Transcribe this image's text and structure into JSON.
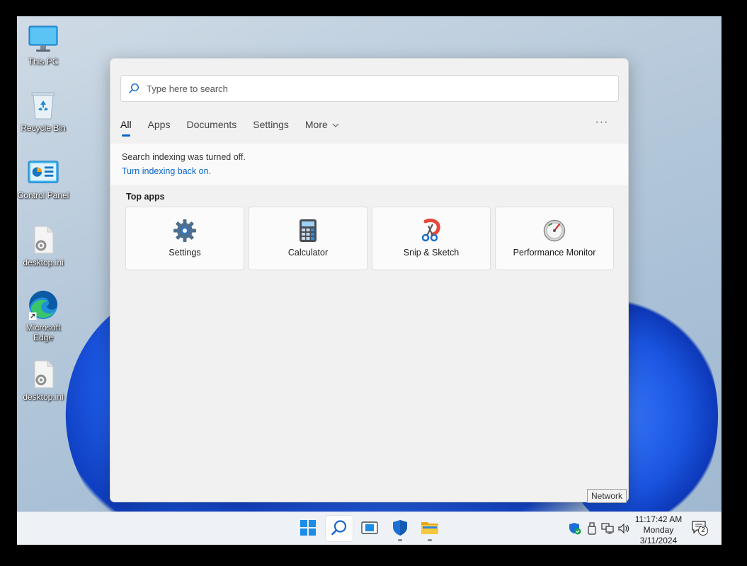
{
  "desktop": {
    "icons": [
      {
        "label": "This PC",
        "icon": "monitor-icon"
      },
      {
        "label": "Recycle Bin",
        "icon": "recycle-bin-icon"
      },
      {
        "label": "Control Panel",
        "icon": "control-panel-icon"
      },
      {
        "label": "desktop.ini",
        "icon": "settings-file-icon"
      },
      {
        "label": "Microsoft Edge",
        "icon": "edge-icon"
      },
      {
        "label": "desktop.ini",
        "icon": "settings-file-icon"
      }
    ]
  },
  "search": {
    "placeholder": "Type here to search",
    "tabs": [
      {
        "label": "All",
        "active": true
      },
      {
        "label": "Apps"
      },
      {
        "label": "Documents"
      },
      {
        "label": "Settings"
      },
      {
        "label": "More",
        "icon": "chevron-down-icon"
      }
    ],
    "more_options": "···",
    "notice_text": "Search indexing was turned off.",
    "notice_link": "Turn indexing back on.",
    "top_apps_label": "Top apps",
    "top_apps": [
      {
        "name": "Settings",
        "icon": "gear-icon"
      },
      {
        "name": "Calculator",
        "icon": "calculator-icon"
      },
      {
        "name": "Snip & Sketch",
        "icon": "snip-sketch-icon"
      },
      {
        "name": "Performance Monitor",
        "icon": "performance-monitor-icon"
      }
    ]
  },
  "tooltip": "Network",
  "taskbar": {
    "clock": {
      "time": "11:17:42 AM",
      "day": "Monday",
      "date": "3/11/2024"
    },
    "notification_count": "2"
  },
  "colors": {
    "accent": "#0a64c8",
    "taskbar": "#eef1f5",
    "panel": "#f1f1f1"
  }
}
